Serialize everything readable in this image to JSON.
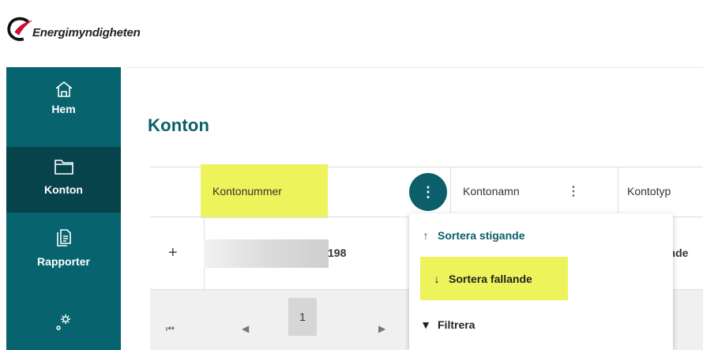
{
  "brand": {
    "name": "Energimyndigheten"
  },
  "sidebar": {
    "items": [
      {
        "label": "Hem",
        "icon": "home-icon"
      },
      {
        "label": "Konton",
        "icon": "folder-icon",
        "active": true
      },
      {
        "label": "Rapporter",
        "icon": "report-copy-icon"
      },
      {
        "label": "",
        "icon": "settings-gears-icon"
      }
    ]
  },
  "page": {
    "title": "Konton"
  },
  "grid": {
    "columns": [
      "Kontonummer",
      "Kontonamn",
      "Kontotyp"
    ],
    "row": {
      "expand": "+",
      "account_suffix": "198",
      "kontotyp_partial": "unde"
    },
    "pager": {
      "first": "⏮",
      "prev": "◀",
      "page": "1",
      "next": "▶"
    }
  },
  "column_menu": {
    "items": [
      {
        "glyph": "↑",
        "label": "Sortera stigande"
      },
      {
        "glyph": "↓",
        "label": "Sortera fallande"
      },
      {
        "glyph": "▼",
        "label": "Filtrera"
      }
    ]
  },
  "colors": {
    "sidebar": "#07636e",
    "sidebar_active": "#06434b",
    "accent": "#0b5e6a",
    "highlight": "#ecf35b",
    "logo_red": "#c8102e"
  }
}
